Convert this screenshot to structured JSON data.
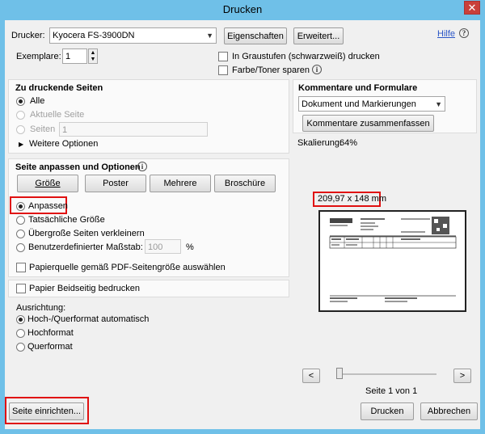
{
  "window": {
    "title": "Drucken",
    "close_glyph": "✕"
  },
  "header": {
    "printer_label": "Drucker:",
    "printer_value": "Kyocera FS-3900DN",
    "properties_button": "Eigenschaften",
    "advanced_button": "Erweitert...",
    "help_link": "Hilfe",
    "help_icon": "?",
    "copies_label": "Exemplare:",
    "copies_value": "1",
    "grayscale_label": "In Graustufen (schwarzweiß) drucken",
    "toner_label": "Farbe/Toner sparen",
    "info_icon": "i"
  },
  "pages_section": {
    "title": "Zu druckende Seiten",
    "options": [
      "Alle",
      "Aktuelle Seite",
      "Seiten"
    ],
    "pages_value": "1",
    "more_options": "Weitere Optionen"
  },
  "sizing_section": {
    "title": "Seite anpassen und Optionen",
    "info_icon": "i",
    "buttons": [
      "Größe",
      "Poster",
      "Mehrere",
      "Broschüre"
    ],
    "options": [
      "Anpassen",
      "Tatsächliche Größe",
      "Übergroße Seiten verkleinern",
      "Benutzerdefinierter Maßstab:"
    ],
    "scale_value": "100",
    "scale_unit": "%",
    "pdf_paper_source": "Papierquelle gemäß PDF-Seitengröße auswählen"
  },
  "duplex_section": {
    "label": "Papier Beidseitig bedrucken"
  },
  "orientation_section": {
    "title": "Ausrichtung:",
    "options": [
      "Hoch-/Querformat automatisch",
      "Hochformat",
      "Querformat"
    ]
  },
  "comments_section": {
    "title": "Kommentare und Formulare",
    "select_value": "Dokument und Markierungen",
    "summarize_button": "Kommentare zusammenfassen"
  },
  "preview": {
    "scaling_label": "Skalierung:",
    "scaling_value": "64%",
    "dimensions": "209,97 x 148 mm",
    "prev_glyph": "<",
    "next_glyph": ">",
    "page_info": "Seite 1 von 1"
  },
  "footer": {
    "page_setup_button": "Seite einrichten...",
    "print_button": "Drucken",
    "cancel_button": "Abbrechen"
  },
  "colors": {
    "titlebar": "#6fc0e8",
    "highlight": "#e01010",
    "close": "#c9403a"
  }
}
